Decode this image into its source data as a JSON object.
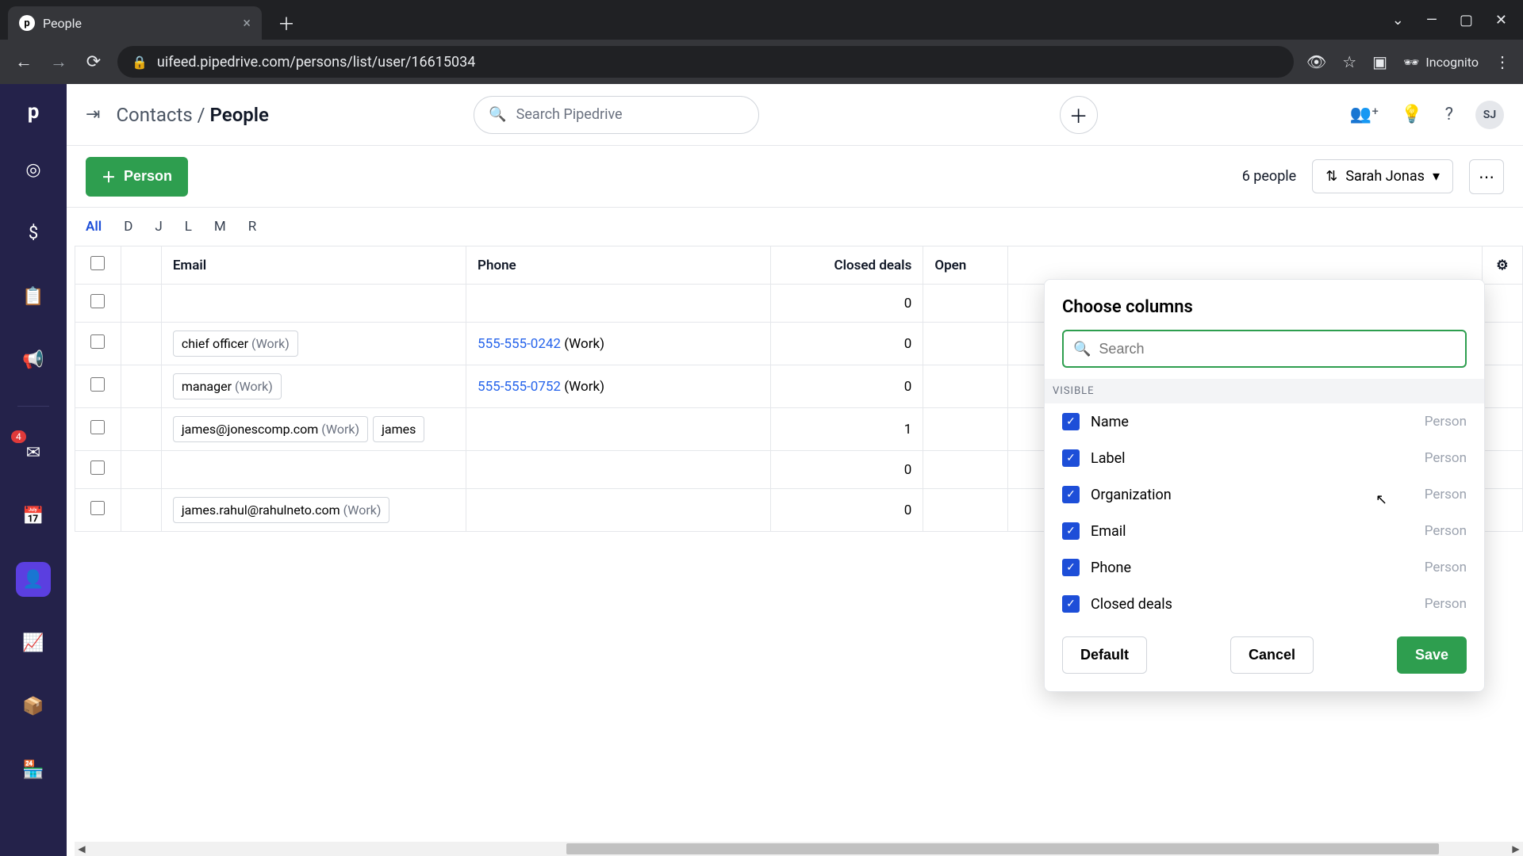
{
  "browser": {
    "tab_title": "People",
    "url": "uifeed.pipedrive.com/persons/list/user/16615034",
    "incognito_label": "Incognito"
  },
  "header": {
    "breadcrumb_parent": "Contacts",
    "breadcrumb_sep": "/",
    "breadcrumb_current": "People",
    "search_placeholder": "Search Pipedrive",
    "avatar_initials": "SJ"
  },
  "toolbar": {
    "add_label": "Person",
    "count_text": "6 people",
    "owner_filter": "Sarah Jonas"
  },
  "letters": [
    "All",
    "D",
    "J",
    "L",
    "M",
    "R"
  ],
  "active_letter": "All",
  "columns": {
    "email": "Email",
    "phone": "Phone",
    "closed": "Closed deals",
    "open": "Open"
  },
  "rows": [
    {
      "email": [],
      "phone": null,
      "closed": "0"
    },
    {
      "email": [
        {
          "text": "chief officer",
          "tag": "(Work)"
        }
      ],
      "phone": {
        "num": "555-555-0242",
        "tag": "(Work)"
      },
      "closed": "0"
    },
    {
      "email": [
        {
          "text": "manager",
          "tag": "(Work)"
        }
      ],
      "phone": {
        "num": "555-555-0752",
        "tag": "(Work)"
      },
      "closed": "0"
    },
    {
      "email": [
        {
          "text": "james@jonescomp.com",
          "tag": "(Work)"
        },
        {
          "text": "james",
          "tag": ""
        }
      ],
      "phone": null,
      "closed": "1"
    },
    {
      "email": [],
      "phone": null,
      "closed": "0"
    },
    {
      "email": [
        {
          "text": "james.rahul@rahulneto.com",
          "tag": "(Work)"
        }
      ],
      "phone": null,
      "closed": "0"
    }
  ],
  "popover": {
    "title": "Choose columns",
    "search_placeholder": "Search",
    "section_label": "VISIBLE",
    "items": [
      {
        "label": "Name",
        "cat": "Person",
        "checked": true
      },
      {
        "label": "Label",
        "cat": "Person",
        "checked": true
      },
      {
        "label": "Organization",
        "cat": "Person",
        "checked": true
      },
      {
        "label": "Email",
        "cat": "Person",
        "checked": true
      },
      {
        "label": "Phone",
        "cat": "Person",
        "checked": true
      },
      {
        "label": "Closed deals",
        "cat": "Person",
        "checked": true
      }
    ],
    "default_label": "Default",
    "cancel_label": "Cancel",
    "save_label": "Save"
  },
  "sidebar": {
    "mail_badge": "4"
  }
}
